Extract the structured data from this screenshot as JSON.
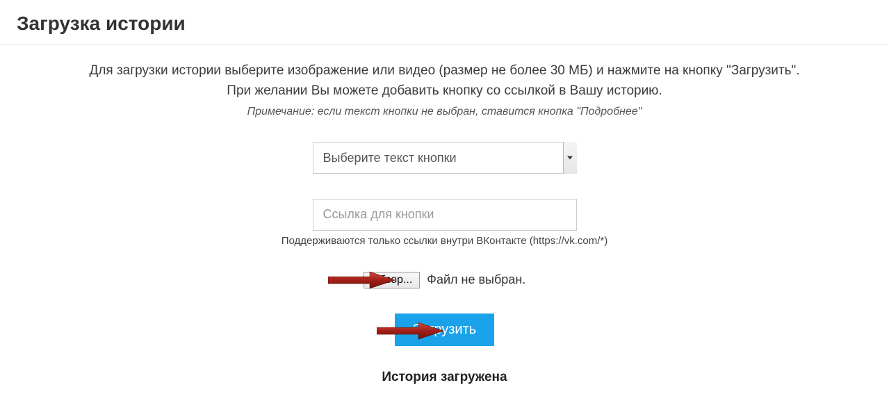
{
  "header": {
    "title": "Загрузка истории"
  },
  "intro": {
    "line1": "Для загрузки истории выберите изображение или видео (размер не более 30 МБ) и нажмите на кнопку \"Загрузить\".",
    "line2": "При желании Вы можете добавить кнопку со ссылкой в Вашу историю.",
    "note": "Примечание: если текст кнопки не выбран, ставится кнопка \"Подробнее\""
  },
  "form": {
    "button_text_select_placeholder": "Выберите текст кнопки",
    "link_placeholder": "Ссылка для кнопки",
    "link_support_note": "Поддерживаются только ссылки внутри ВКонтакте (https://vk.com/*)",
    "browse_label": "Обзор...",
    "file_status": "Файл не выбран.",
    "upload_label": "Загрузить"
  },
  "status": {
    "uploaded": "История загружена"
  },
  "icons": {
    "caret": "chevron-down-icon"
  }
}
